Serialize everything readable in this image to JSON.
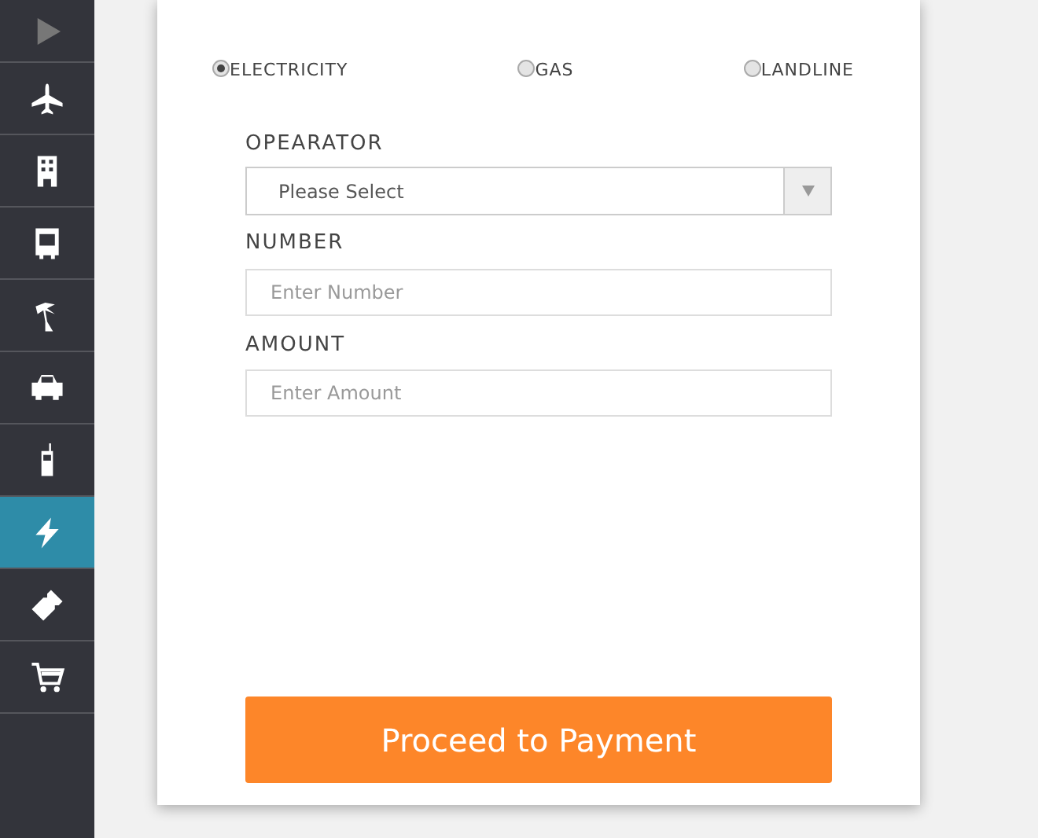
{
  "sidebar": {
    "items": [
      {
        "kind": "expand",
        "selected": false
      },
      {
        "kind": "plane",
        "selected": false
      },
      {
        "kind": "building",
        "selected": false
      },
      {
        "kind": "bus",
        "selected": false
      },
      {
        "kind": "palm",
        "selected": false
      },
      {
        "kind": "car",
        "selected": false
      },
      {
        "kind": "phone",
        "selected": false
      },
      {
        "kind": "bolt",
        "selected": true
      },
      {
        "kind": "ticket",
        "selected": false
      },
      {
        "kind": "cart",
        "selected": false
      }
    ]
  },
  "bill_types": [
    {
      "label": "ELECTRICITY",
      "selected": true
    },
    {
      "label": "GAS",
      "selected": false
    },
    {
      "label": "LANDLINE",
      "selected": false
    }
  ],
  "form": {
    "operator": {
      "label": "OPEARATOR",
      "value": "Please Select"
    },
    "number": {
      "label": "NUMBER",
      "placeholder": "Enter Number"
    },
    "amount": {
      "label": "AMOUNT",
      "placeholder": "Enter Amount"
    }
  },
  "submit": "Proceed to Payment"
}
